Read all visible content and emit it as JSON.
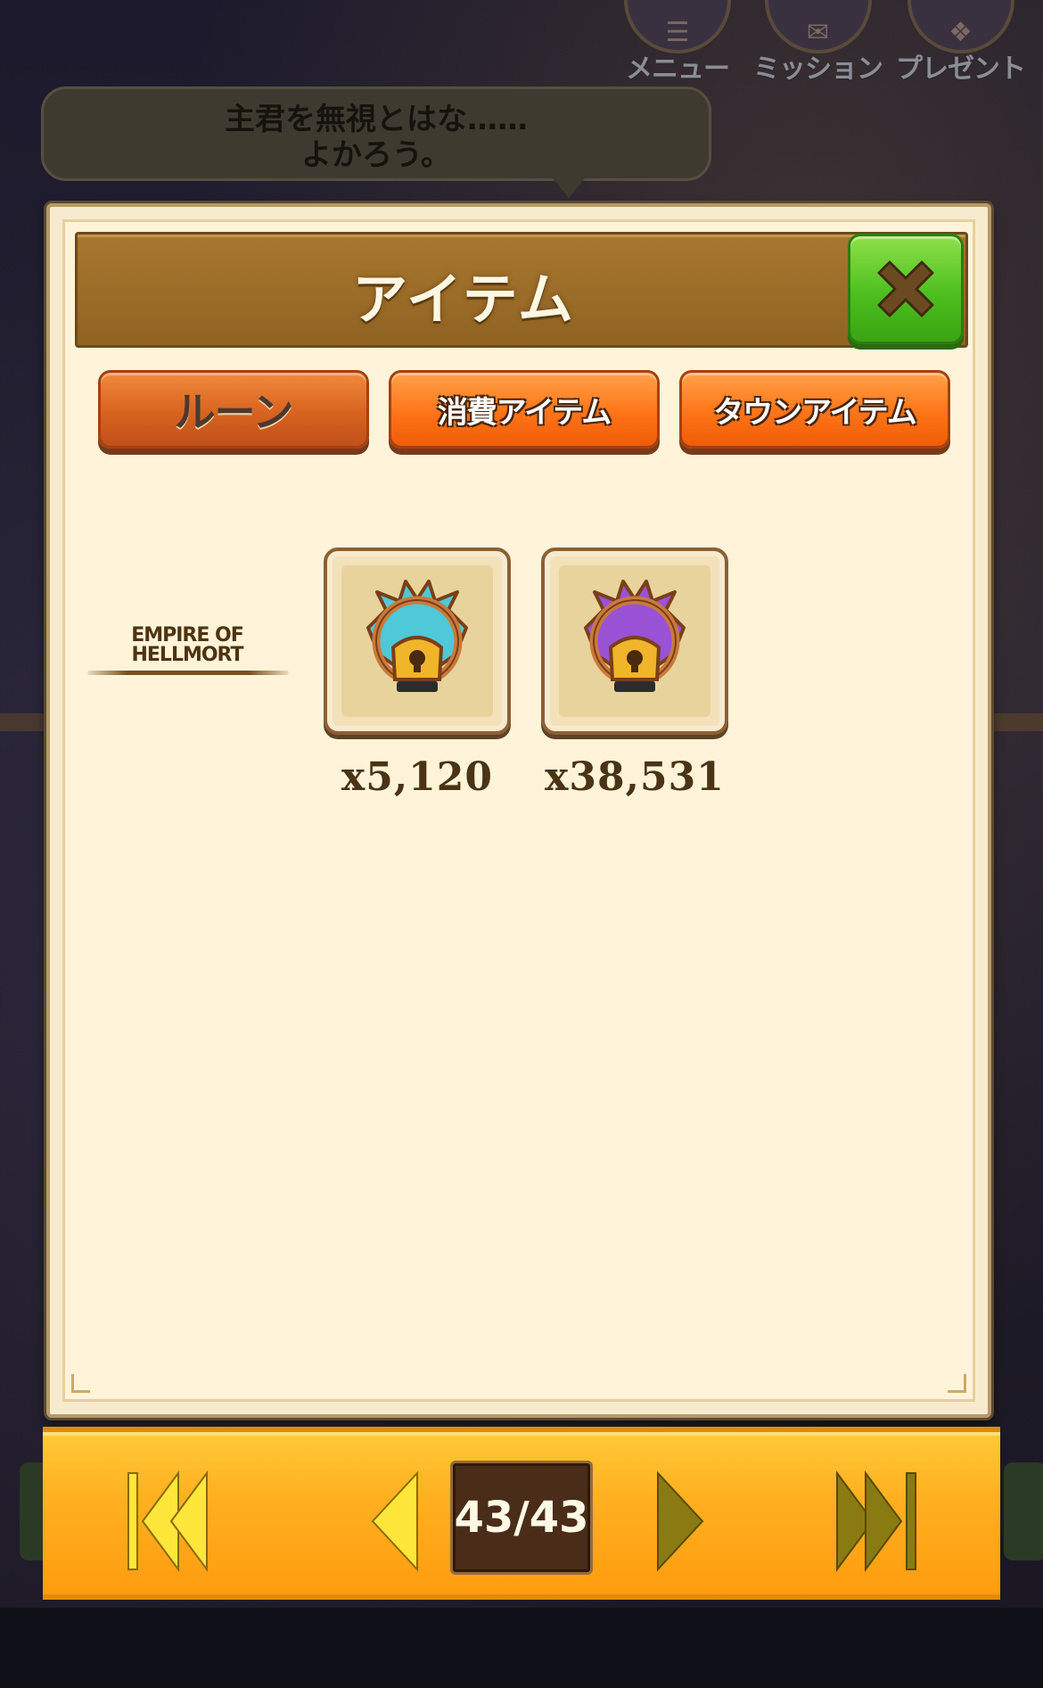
{
  "top_menu": [
    {
      "label": "メニュー"
    },
    {
      "label": "ミッション"
    },
    {
      "label": "プレゼント"
    }
  ],
  "speech_bubble": {
    "line1": "主君を無視とはな……",
    "line2": "よかろう。"
  },
  "modal": {
    "title": "アイテム",
    "tabs": [
      {
        "label": "ルーン",
        "active": true
      },
      {
        "label": "消費アイテム",
        "active": false
      },
      {
        "label": "タウンアイテム",
        "active": false
      }
    ],
    "section": {
      "label_line1": "EMPIRE OF",
      "label_line2": "HELLMORT"
    },
    "items": [
      {
        "icon": "blue-rune-lock-icon",
        "gem_color": "#4fc8d8",
        "count": "x5,120"
      },
      {
        "icon": "purple-rune-lock-icon",
        "gem_color": "#9a52d6",
        "count": "x38,531"
      }
    ]
  },
  "pager": {
    "page_text": "43/43",
    "first_icon": "skip-first-icon",
    "prev_icon": "prev-icon",
    "next_icon": "next-icon",
    "last_icon": "skip-last-icon",
    "enabled_color": "#ffe63a",
    "disabled_color": "#8a7a12"
  }
}
